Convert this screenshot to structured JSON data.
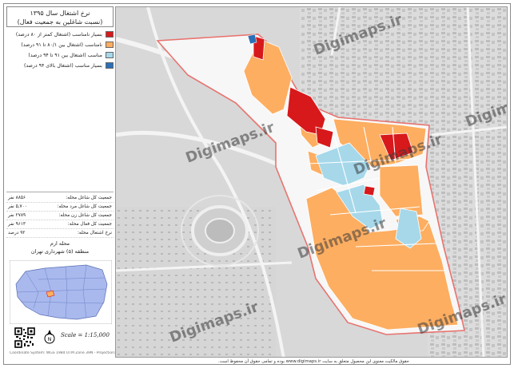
{
  "panel": {
    "title_line1": "نرخ اشتغال سال ۱۳۹۵",
    "title_line2": "(نسبت شاغلین به جمعیت فعال)"
  },
  "legend": [
    {
      "label": "بسیار نامناسب (اشتغال کمتر از ۸۰ درصد)",
      "color": "#d7191c"
    },
    {
      "label": "نامناسب (اشتغال بین ۸۰/۱ تا ۹۱ درصد)",
      "color": "#fdae61"
    },
    {
      "label": "مناسب (اشتغال بین ۹۱ تا ۹۴ درصد)",
      "color": "#a6d8ea"
    },
    {
      "label": "بسیار مناسب (اشتغال بالای ۹۴ درصد)",
      "color": "#2b6fb6"
    }
  ],
  "stats": [
    {
      "key": "جمعیت کل شاغل محله:",
      "value": "۸۸۵۶ نفر"
    },
    {
      "key": "جمعیت کل شاغل مرد محله:",
      "value": "۵,۷۰۰ نفر"
    },
    {
      "key": "جمعیت کل شاغل زن محله:",
      "value": "۲۷۸۹ نفر"
    },
    {
      "key": "جمعیت کل فعال محله:",
      "value": "۹۶۱۳ نفر"
    },
    {
      "key": "نرخ اشتغال محله:",
      "value": "۹۲ درصد"
    }
  ],
  "location": {
    "line1": "محله ارم",
    "line2": "منطقه (۵) شهرداری تهران"
  },
  "scale_text": "Scale = 1:15,000",
  "credit": "Coordinate System: WGS 1984 UTM Zone 39N - Projection: Transverse Mercator",
  "watermark": "Digimaps.ir",
  "footer": "حقوق مالکیت معنوی این محصول متعلق به سایت www.digimaps.ir بوده و تمامی حقوق آن محفوظ است.",
  "colors": {
    "very_poor": "#d7191c",
    "poor": "#fdae61",
    "good": "#a6d8ea",
    "very_good": "#2b6fb6",
    "basemap": "#d9d9d9",
    "boundary": "#e8736f"
  },
  "icons": [
    "north-arrow-icon",
    "qr-code-icon"
  ]
}
